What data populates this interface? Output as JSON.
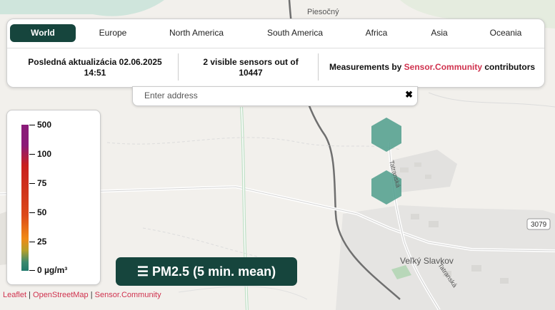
{
  "regions": [
    "World",
    "Europe",
    "North America",
    "South America",
    "Africa",
    "Asia",
    "Oceania"
  ],
  "last_update": "Posledná aktualizácia 02.06.2025 14:51",
  "sensor_count": "2  visible sensors out of 10447",
  "measurements_prefix": "Measurements by",
  "measurements_link": "Sensor.Community",
  "measurements_suffix": "contributors",
  "search": {
    "placeholder": "Enter address",
    "clear": "✖"
  },
  "legend": {
    "labels": [
      "500",
      "100",
      "75",
      "50",
      "25",
      "0 µg/m³"
    ]
  },
  "pm_button": "☰ PM2.5 (5 min. mean)",
  "map_labels": {
    "village": "Veľký Slavkov",
    "road1": "Tatranská",
    "road2": "Tatranská",
    "north": "Piesočný",
    "road_number": "3079"
  },
  "attribution": {
    "leaflet": "Leaflet",
    "sep1": "|",
    "osm": "OpenStreetMap",
    "sep2": "|",
    "sc": "Sensor.Community"
  },
  "colors": {
    "accent": "#d0324e",
    "dark": "#16453d",
    "hex": "#4f9e8c"
  }
}
